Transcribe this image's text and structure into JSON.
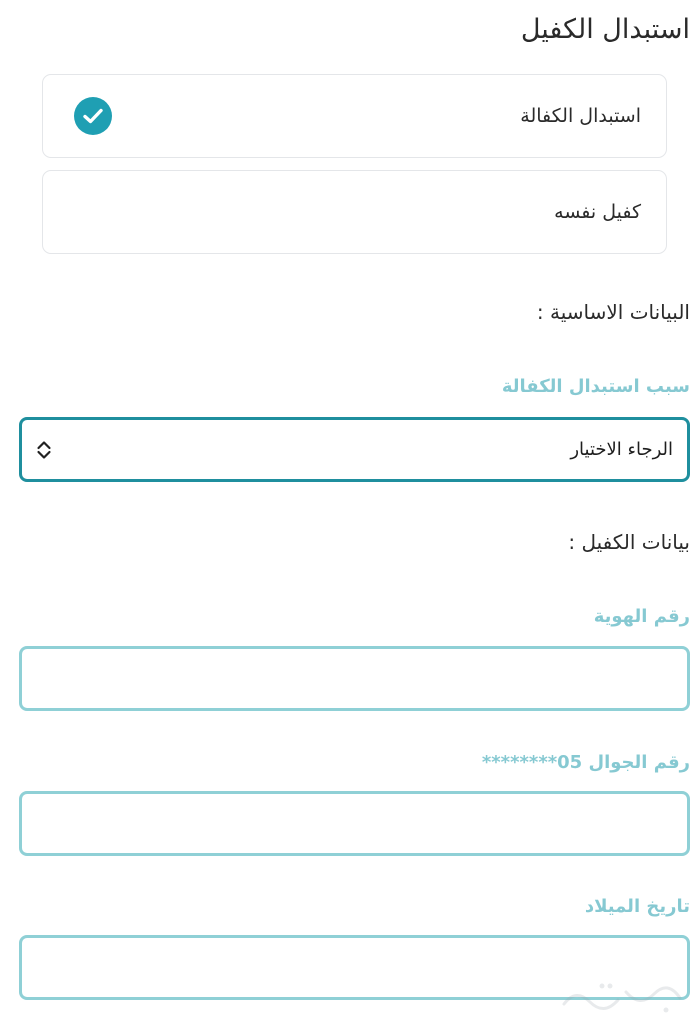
{
  "page": {
    "title": "استبدال الكفيل"
  },
  "options": [
    {
      "label": "استبدال الكفالة",
      "selected": true,
      "icon": "check-circle-icon"
    },
    {
      "label": "كفيل نفسه",
      "selected": false
    }
  ],
  "basic_section": {
    "heading": "البيانات الاساسية :",
    "reason_label": "سبب استبدال الكفالة",
    "reason_value": "الرجاء الاختيار",
    "reason_icon": "chevron-up-down-icon"
  },
  "guarantor_section": {
    "heading": "بيانات الكفيل :",
    "id_label": "رقم الهوية",
    "id_value": "",
    "mobile_label": "رقم الجوال 05********",
    "mobile_value": "",
    "dob_label": "تاريخ الميلاد",
    "dob_value": ""
  },
  "colors": {
    "accent": "#1f9fb3",
    "label": "#86c9d2",
    "input_border": "#8fd0d6",
    "select_border": "#1f8f9e"
  }
}
